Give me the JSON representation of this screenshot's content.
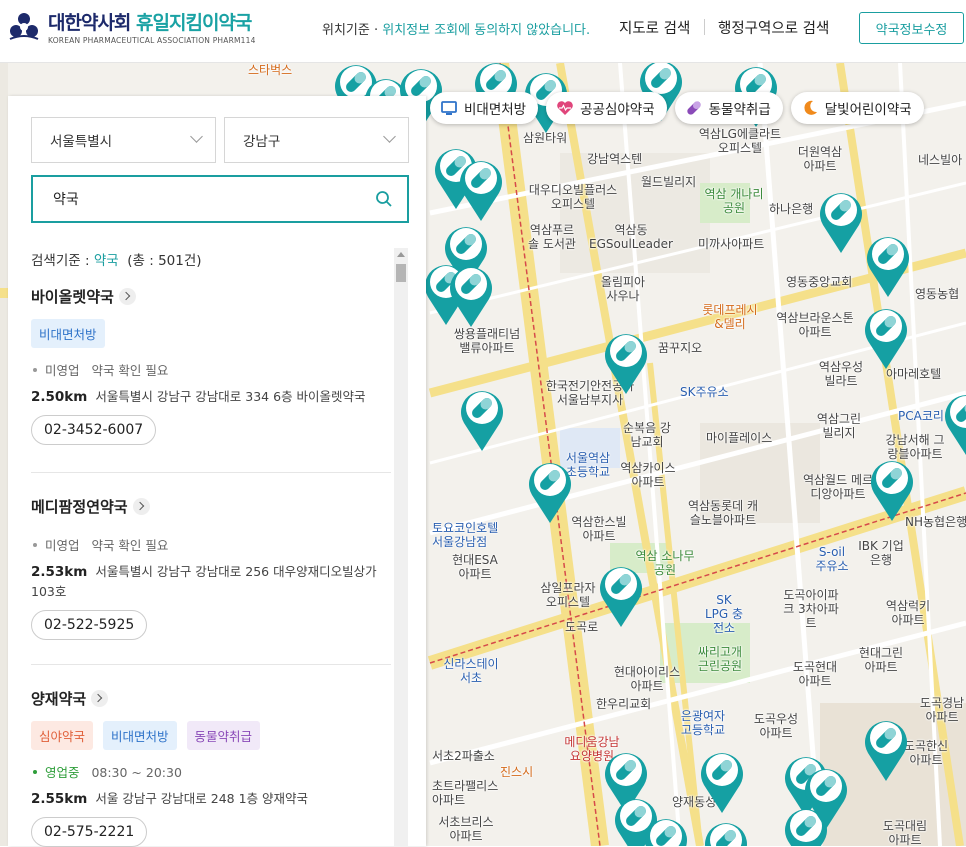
{
  "header": {
    "logo_title_main": "대한약사회",
    "logo_title_accent": "휴일지킴이약국",
    "logo_subtitle": "KOREAN PHARMACEUTICAL ASSOCIATION PHARM114",
    "location_prefix": "위치기준 · ",
    "location_status": "위치정보 조회에 동의하지 않았습니다.",
    "nav_map_search": "지도로 검색",
    "nav_region_search": "행정구역으로 검색",
    "edit_button": "약국정보수정"
  },
  "filters": [
    {
      "label": "비대면처방",
      "icon": "monitor-icon",
      "color": "#2f73c9"
    },
    {
      "label": "공공심야약국",
      "icon": "heart-pulse-icon",
      "color": "#e0457b"
    },
    {
      "label": "동물약취급",
      "icon": "capsule-icon",
      "color": "#8a4ab8"
    },
    {
      "label": "달빛어린이약국",
      "icon": "moon-icon",
      "color": "#f08a1c"
    }
  ],
  "search": {
    "city": "서울특별시",
    "district": "강남구",
    "query": "약국",
    "criteria_label": "검색기준 : ",
    "criteria_keyword": "약국",
    "total": "(총 : 501건)"
  },
  "pharmacies": [
    {
      "name": "바이올렛약국",
      "tags": [
        {
          "label": "비대면처방",
          "style": "blue"
        }
      ],
      "status": "미영업",
      "status_note": "약국 확인 필요",
      "distance": "2.50km",
      "address": "서울특별시 강남구 강남대로 334 6층 바이올렛약국",
      "phone": "02-3452-6007"
    },
    {
      "name": "메디팜정연약국",
      "tags": [],
      "status": "미영업",
      "status_note": "약국 확인 필요",
      "distance": "2.53km",
      "address": "서울특별시 강남구 강남대로 256 대우양재디오빌상가 103호",
      "phone": "02-522-5925"
    },
    {
      "name": "양재약국",
      "tags": [
        {
          "label": "심야약국",
          "style": "orange"
        },
        {
          "label": "비대면처방",
          "style": "blue"
        },
        {
          "label": "동물약취급",
          "style": "purple"
        }
      ],
      "status": "영업중",
      "status_note": "08:30 ~ 20:30",
      "distance": "2.55km",
      "address": "서울 강남구 강남대로 248 1층 양재약국",
      "phone": "02-575-2221"
    }
  ],
  "map_labels": [
    "스타벅스",
    "삼원타워",
    "강남역스텐",
    "월드빌리지",
    "대우디오빌플러스 오피스텔",
    "역삼LG에클라트 오피스텔",
    "역삼 개나리공원",
    "하나은행",
    "더원역삼 아파트",
    "네스빌아",
    "역삼푸르솔 도서관",
    "역삼동 EGSoulLeader",
    "미까사아파트",
    "올림피아 사우나",
    "영동중앙교회",
    "영동농협",
    "롯데프레시 &델리",
    "역삼브라운스톤 아파트",
    "쌍용플래티넘 밸류아파트",
    "꿈꾸지오",
    "한국전기안전공사 서울남부지사",
    "SK주유소",
    "역삼우성 빌라트",
    "아마레호텔",
    "PCA코리",
    "서울역삼 초등학교",
    "순복음 강남교회",
    "마이플레이스",
    "역삼그린 빌리지",
    "강남서해 그랑블아파트",
    "역삼카이스 아파트",
    "역삼동롯데 캐슬노블아파트",
    "역삼월드 메르디앙아파트",
    "NH농협은행",
    "역삼한스빌 아파트",
    "역삼 소나무공원",
    "S-oil 주유소",
    "IBK 기업은행",
    "토요코인호텔 서울강남점",
    "현대ESA 아파트",
    "삼일프라자 오피스텔",
    "SK LPG 충전소",
    "도곡아이파크 3차아파트",
    "역삼럭키 아파트",
    "싸리고개 근린공원",
    "신라스테이 서초",
    "현대아이리스 아파트",
    "도곡현대 아파트",
    "현대그린 아파트",
    "도곡경남 아파트",
    "은광여자 고등학교",
    "도곡우성 아파트",
    "한우리교회",
    "메디움강남 요양병원",
    "서초2파출소",
    "진스시",
    "초트라팰리스 아파트",
    "양재동성당",
    "서초브리스 아파트",
    "도곡대림 아파트",
    "도곡한신 아파트",
    "도곡로",
    "비대면처방"
  ]
}
